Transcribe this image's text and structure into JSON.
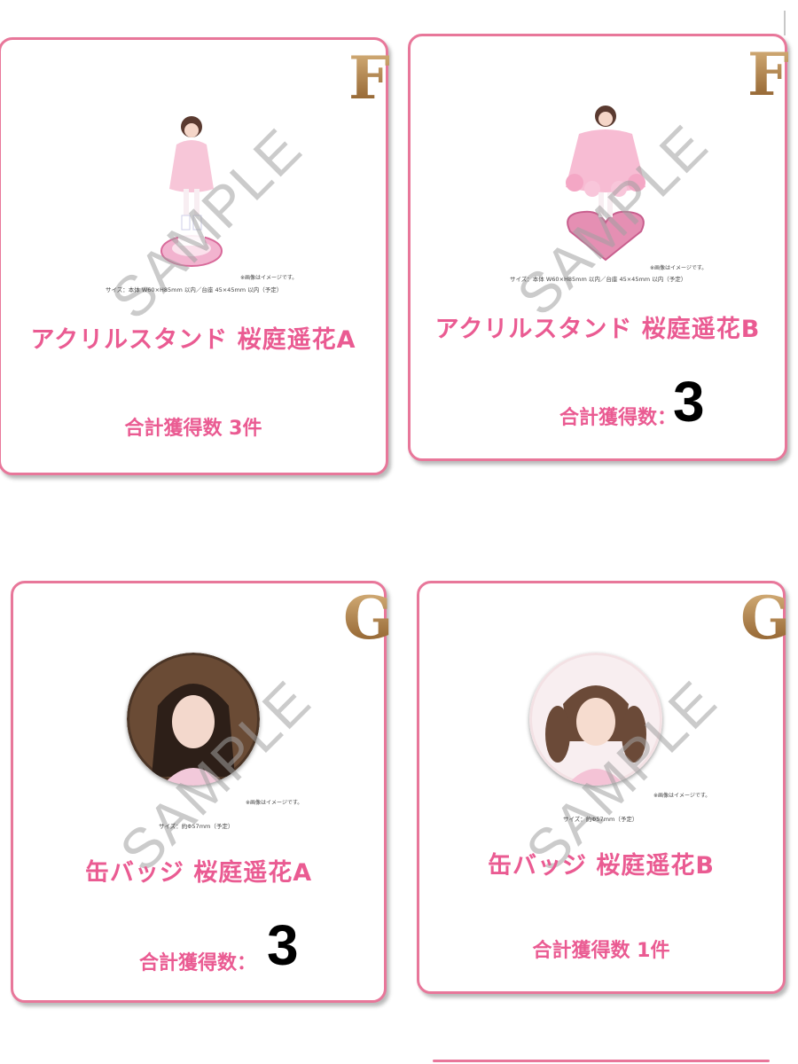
{
  "cards": [
    {
      "rank": "F",
      "note": "※画像はイメージです。",
      "size_text": "サイズ：本体 W60×H85mm 以内／台座 45×45mm 以内（予定）",
      "watermark": "SAMPLE",
      "title": "アクリルスタンド 桜庭遥花A",
      "total_text": "合計獲得数 3件",
      "big_count": ""
    },
    {
      "rank": "F",
      "note": "※画像はイメージです。",
      "size_text": "サイズ：本体 W60×H85mm 以内／台座 45×45mm 以内（予定）",
      "watermark": "SAMPLE",
      "title": "アクリルスタンド 桜庭遥花B",
      "total_text": "合計獲得数：",
      "big_count": "3"
    },
    {
      "rank": "G",
      "note": "※画像はイメージです。",
      "size_text": "サイズ：約Φ57mm（予定）",
      "watermark": "SAMPLE",
      "title": "缶バッジ 桜庭遥花A",
      "total_text": "合計獲得数：",
      "big_count": "3"
    },
    {
      "rank": "G",
      "note": "※画像はイメージです。",
      "size_text": "サイズ：約Φ57mm（予定）",
      "watermark": "SAMPLE",
      "title": "缶バッジ 桜庭遥花B",
      "total_text": "合計獲得数 1件",
      "big_count": ""
    }
  ],
  "colors": {
    "border": "#e8779a",
    "title": "#ea5b92",
    "rank_gold": "#b4884e"
  }
}
